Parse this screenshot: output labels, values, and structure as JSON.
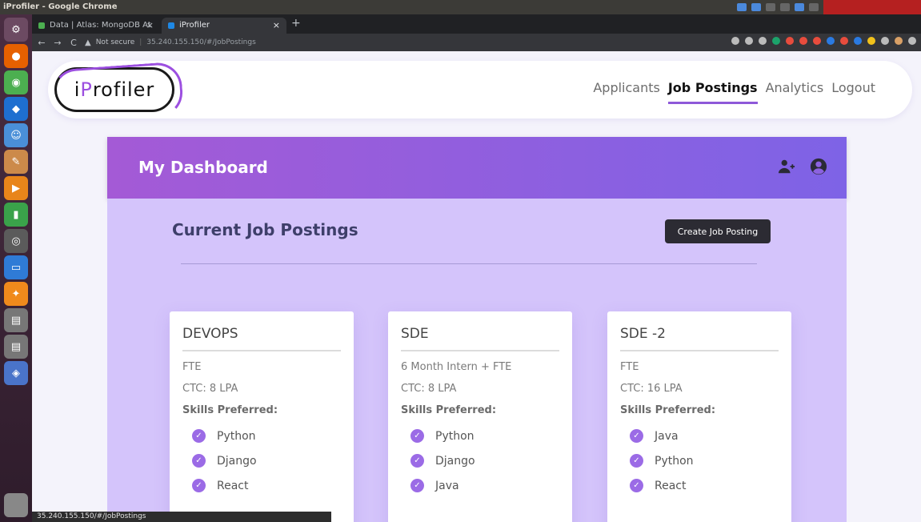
{
  "os": {
    "window_title": "iProfiler - Google Chrome"
  },
  "launcher": {
    "items": [
      "ubuntu-settings",
      "firefox",
      "chrome",
      "vscode",
      "finder",
      "text-editor",
      "media-player",
      "charts",
      "system-settings",
      "presentation",
      "safari",
      "drive",
      "drive",
      "network"
    ]
  },
  "browser": {
    "tabs": [
      {
        "label": "Data | Atlas: MongoDB At",
        "favicon_color": "#4caf50"
      },
      {
        "label": "iProfiler",
        "favicon_color": "#1e88e5"
      }
    ],
    "address": {
      "security": "Not secure",
      "url": "35.240.155.150/#/JobPostings"
    },
    "status_url": "35.240.155.150/#/JobPostings"
  },
  "nav": {
    "logo_prefix": "i",
    "logo_highlight": "P",
    "logo_suffix": "rofiler",
    "links": [
      "Applicants",
      "Job Postings",
      "Analytics",
      "Logout"
    ],
    "active": "Job Postings"
  },
  "dashboard": {
    "title": "My Dashboard",
    "section_title": "Current Job Postings",
    "create_button": "Create Job Posting",
    "cards": [
      {
        "title": "DEVOPS",
        "type": "FTE",
        "ctc": "CTC: 8 LPA",
        "skills_label": "Skills Preferred:",
        "skills": [
          "Python",
          "Django",
          "React"
        ]
      },
      {
        "title": "SDE",
        "type": "6 Month Intern + FTE",
        "ctc": "CTC: 8 LPA",
        "skills_label": "Skills Preferred:",
        "skills": [
          "Python",
          "Django",
          "Java"
        ]
      },
      {
        "title": "SDE -2",
        "type": "FTE",
        "ctc": "CTC: 16 LPA",
        "skills_label": "Skills Preferred:",
        "skills": [
          "Java",
          "Python",
          "React"
        ]
      }
    ]
  },
  "colors": {
    "accent": "#8e59d9",
    "header_start": "#a45ad6",
    "header_end": "#7e63e6",
    "body_bg": "#d4c4fb"
  }
}
